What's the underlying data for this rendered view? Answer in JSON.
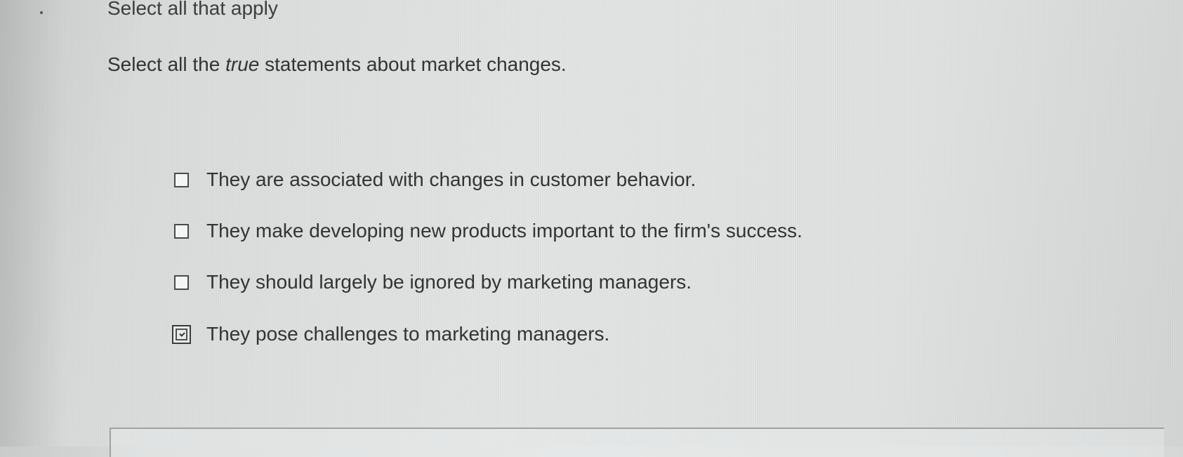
{
  "header": {
    "instruction": "Select all that apply"
  },
  "question": {
    "prefix": "Select all the ",
    "emphasis": "true",
    "suffix": " statements about market changes."
  },
  "options": [
    {
      "label": "They are associated with changes in customer behavior.",
      "checked": false
    },
    {
      "label": "They make developing new products important to the firm's success.",
      "checked": false
    },
    {
      "label": "They should largely be ignored by marketing managers.",
      "checked": false
    },
    {
      "label": "They pose challenges to marketing managers.",
      "checked": true
    }
  ],
  "colors": {
    "text": "#333333",
    "checkbox_border": "#4a4a4a",
    "background": "#dfe1e1"
  }
}
